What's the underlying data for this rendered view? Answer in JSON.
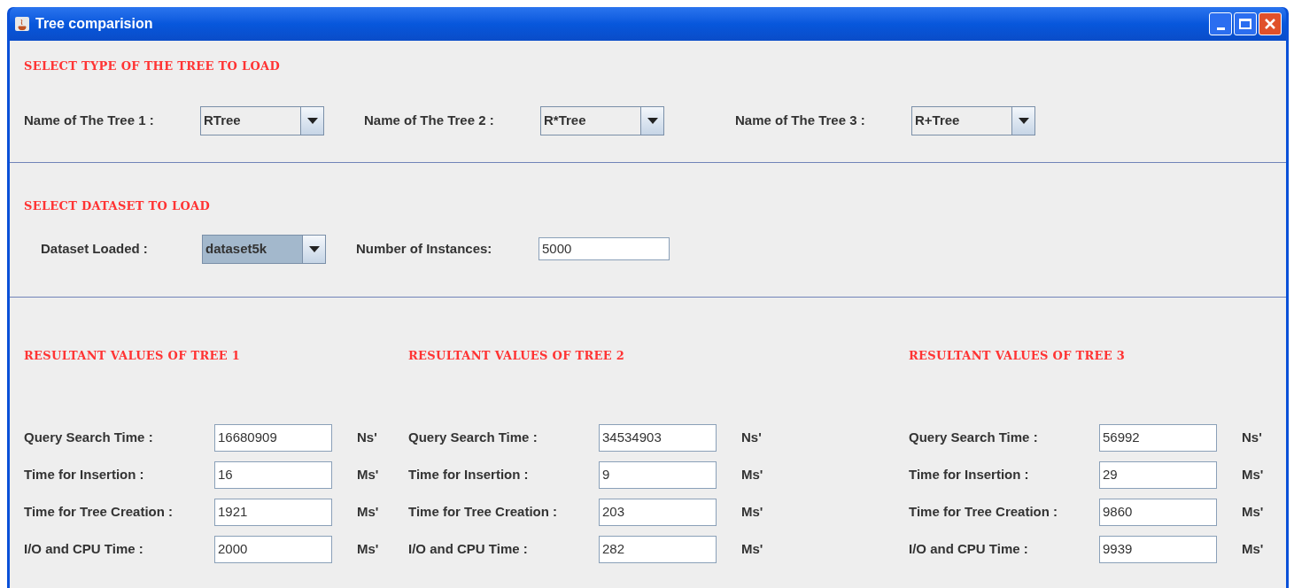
{
  "window": {
    "title": "Tree comparision"
  },
  "tree_section": {
    "heading": "SELECT TYPE OF THE TREE TO LOAD",
    "selectors": [
      {
        "label": "Name of The Tree 1 :",
        "value": "RTree",
        "focused": false
      },
      {
        "label": "Name of The Tree 2 :",
        "value": "R*Tree",
        "focused": false
      },
      {
        "label": "Name of The Tree 3 :",
        "value": "R+Tree",
        "focused": false
      }
    ]
  },
  "dataset_section": {
    "heading": "SELECT DATASET TO LOAD",
    "dataset": {
      "label": "Dataset Loaded :",
      "value": "dataset5k",
      "focused": true
    },
    "instances": {
      "label": "Number of Instances:",
      "value": "5000"
    }
  },
  "results": [
    {
      "heading": "RESULTANT VALUES OF TREE 1",
      "rows": [
        {
          "label": "Query Search Time :",
          "value": "16680909",
          "unit": "Ns'"
        },
        {
          "label": "Time for Insertion :",
          "value": "16",
          "unit": "Ms'"
        },
        {
          "label": "Time for Tree Creation :",
          "value": "1921",
          "unit": "Ms'"
        },
        {
          "label": "I/O and CPU Time :",
          "value": "2000",
          "unit": "Ms'"
        }
      ]
    },
    {
      "heading": "RESULTANT VALUES OF TREE 2",
      "rows": [
        {
          "label": "Query Search Time :",
          "value": "34534903",
          "unit": "Ns'"
        },
        {
          "label": "Time for Insertion :",
          "value": "9",
          "unit": "Ms'"
        },
        {
          "label": "Time for Tree Creation :",
          "value": "203",
          "unit": "Ms'"
        },
        {
          "label": "I/O and CPU Time :",
          "value": "282",
          "unit": "Ms'"
        }
      ]
    },
    {
      "heading": "RESULTANT VALUES OF TREE 3",
      "rows": [
        {
          "label": "Query Search Time :",
          "value": "56992",
          "unit": "Ns'"
        },
        {
          "label": "Time for Insertion :",
          "value": "29",
          "unit": "Ms'"
        },
        {
          "label": "Time for Tree Creation :",
          "value": "9860",
          "unit": "Ms'"
        },
        {
          "label": "I/O and CPU Time :",
          "value": "9939",
          "unit": "Ms'"
        }
      ]
    }
  ]
}
